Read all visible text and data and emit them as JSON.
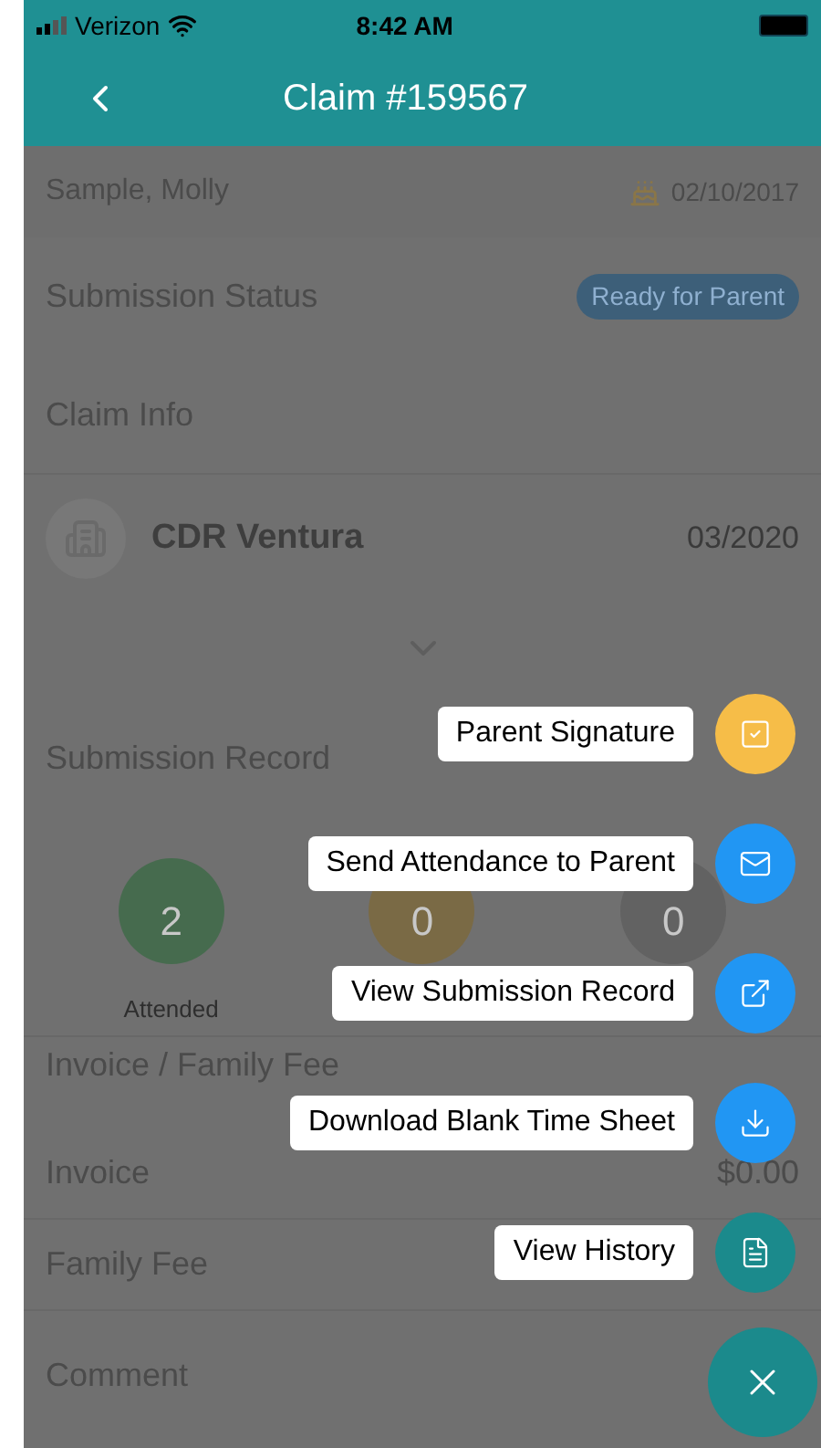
{
  "status_bar": {
    "carrier": "Verizon",
    "time": "8:42 AM"
  },
  "header": {
    "title": "Claim #159567"
  },
  "student": {
    "name": "Sample, Molly",
    "birthday": "02/10/2017"
  },
  "submission_status": {
    "label": "Submission Status",
    "badge": "Ready for Parent"
  },
  "claim_info": {
    "title": "Claim Info",
    "provider": "CDR Ventura",
    "date": "03/2020"
  },
  "submission_record": {
    "title": "Submission Record",
    "stats": [
      {
        "count": "2",
        "label": "Attended",
        "color": "#466b4e"
      },
      {
        "count": "0",
        "color": "#7a6a45"
      },
      {
        "count": "0",
        "color": "#626262"
      }
    ]
  },
  "invoice": {
    "title": "Invoice / Family Fee",
    "rows": [
      {
        "label": "Invoice",
        "value": "$0.00"
      },
      {
        "label": "Family Fee"
      }
    ]
  },
  "comment": {
    "label": "Comment"
  },
  "actions": [
    {
      "label": "Parent Signature",
      "kind": "signature",
      "color": "#f6bd48"
    },
    {
      "label": "Send Attendance to Parent",
      "kind": "mail",
      "color": "#2196f3"
    },
    {
      "label": "View Submission Record",
      "kind": "open",
      "color": "#2196f3"
    },
    {
      "label": "Download Blank Time Sheet",
      "kind": "download",
      "color": "#2196f3"
    },
    {
      "label": "View History",
      "kind": "document",
      "color": "#1b8a8c"
    }
  ],
  "close_button": {
    "color": "#1b8a8c"
  }
}
